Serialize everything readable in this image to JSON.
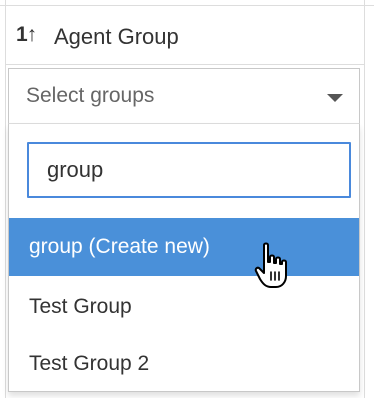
{
  "column": {
    "sort_indicator": "1↑",
    "title": "Agent Group"
  },
  "select": {
    "placeholder": "Select groups"
  },
  "dropdown": {
    "search_value": "group",
    "options": [
      {
        "label": "group (Create new)",
        "highlighted": true
      },
      {
        "label": "Test Group",
        "highlighted": false
      },
      {
        "label": "Test Group 2",
        "highlighted": false
      }
    ]
  },
  "colors": {
    "highlight": "#4a90d9",
    "focus_border": "#4a89dc",
    "text": "#333333"
  },
  "icons": {
    "sort": "sort-ascending-icon",
    "caret": "chevron-down-icon",
    "cursor": "hand-pointer-icon"
  }
}
